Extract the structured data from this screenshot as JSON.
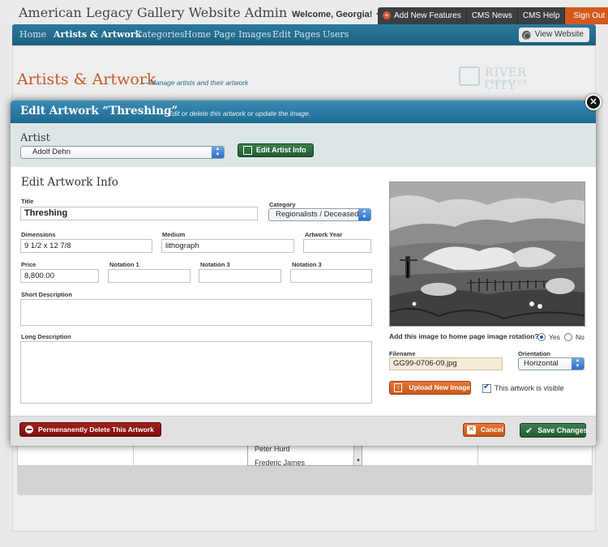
{
  "app": {
    "site_title": "American Legacy Gallery Website Admin",
    "welcome": "Welcome, Georgia!",
    "top_buttons": [
      "Add New Features",
      "CMS News",
      "CMS Help",
      "Sign Out"
    ],
    "nav": [
      "Home",
      "Artists & Artwork",
      "Categories",
      "Home Page Images",
      "Edit Pages",
      "Users"
    ],
    "view_website": "View Website",
    "logo_text": "RIVER CITY",
    "logo_subtext": "CREATIVE"
  },
  "page": {
    "heading": "Artists & Artwork",
    "subheading": "— Manage artists  and their artwork"
  },
  "background_list": {
    "items": [
      "Peter Hurd",
      "Frederic James"
    ]
  },
  "modal": {
    "title": "Edit Artwork “Threshing”",
    "subtitle": "— Edit or delete this artwork or update the image.",
    "close_symbol": "×",
    "artist_label": "Artist",
    "artist_value": "Adolf Dehn",
    "edit_artist_button": "Edit Artist Info",
    "section_title": "Edit Artwork Info",
    "fields": {
      "title_label": "Title",
      "title_value": "Threshing",
      "category_label": "Category",
      "category_value": "Regionalists / Deceased",
      "dimensions_label": "Dimensions",
      "dimensions_value": "9 1/2 x 12 7/8",
      "medium_label": "Medium",
      "medium_value": "lithograph",
      "year_label": "Artwork Year",
      "year_value": "",
      "price_label": "Price",
      "price_value": "8,800.00",
      "notation1_label": "Notation 1",
      "notation1_value": "",
      "notation2_label": "Notation 3",
      "notation2_value": "",
      "notation3_label": "Notation 3",
      "notation3_value": "",
      "short_desc_label": "Short Description",
      "long_desc_label": "Long Description"
    },
    "image_panel": {
      "rotation_question": "Add this image to home page image rotation?",
      "rotation_yes": "Yes",
      "rotation_no": "No",
      "rotation_selected": "Yes",
      "filename_label": "Filename",
      "filename_value": "GG99-0706-09.jpg",
      "orientation_label": "Orientation",
      "orientation_value": "Horizontal",
      "upload_button": "Upload New Image",
      "visible_checkbox_label": "This artwork is visible",
      "visible_checked": true
    },
    "footer": {
      "delete_button": "Permenanently Delete This Artwork",
      "cancel_button": "Cancel",
      "save_button": "Save Changes"
    }
  }
}
